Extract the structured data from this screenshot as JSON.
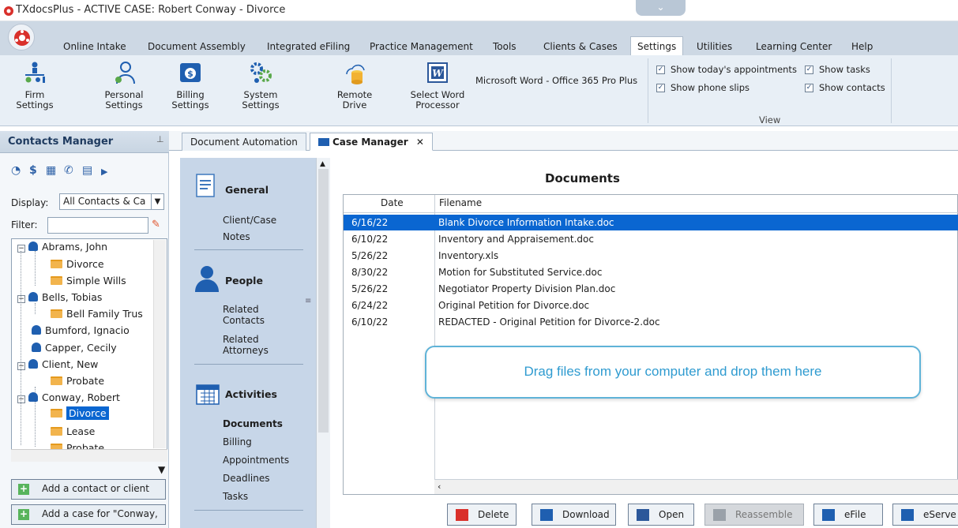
{
  "window": {
    "title": "TXdocsPlus - ACTIVE CASE: Robert Conway - Divorce"
  },
  "ribbon_tabs": [
    "Online Intake",
    "Document Assembly",
    "Integrated eFiling",
    "Practice Management",
    "Tools",
    "Clients & Cases",
    "Settings",
    "Utilities",
    "Learning Center",
    "Help"
  ],
  "active_tab": "Settings",
  "ribbon": {
    "buttons": [
      {
        "line1": "Firm",
        "line2": "Settings",
        "icon": "firm-settings-icon"
      },
      {
        "line1": "Personal",
        "line2": "Settings",
        "icon": "person-settings-icon"
      },
      {
        "line1": "Billing",
        "line2": "Settings",
        "icon": "billing-settings-icon"
      },
      {
        "line1": "System",
        "line2": "Settings",
        "icon": "gears-icon"
      },
      {
        "line1": "Remote",
        "line2": "Drive",
        "icon": "remote-drive-icon"
      },
      {
        "line1": "Select Word",
        "line2": "Processor",
        "icon": "word-icon"
      }
    ],
    "word_processor": "Microsoft Word - Office 365 Pro Plus",
    "checkboxes": [
      {
        "label": "Show today's appointments",
        "checked": true
      },
      {
        "label": "Show tasks",
        "checked": true
      },
      {
        "label": "Show phone slips",
        "checked": true
      },
      {
        "label": "Show contacts",
        "checked": true
      }
    ],
    "group_label": "View"
  },
  "contacts_manager": {
    "title": "Contacts Manager",
    "display_label": "Display:",
    "display_value": "All Contacts & Ca",
    "filter_label": "Filter:",
    "tree": [
      {
        "text": "Abrams, John",
        "type": "person",
        "level": 0,
        "expander": "−"
      },
      {
        "text": "Divorce",
        "type": "case",
        "level": 1
      },
      {
        "text": "Simple Wills",
        "type": "case",
        "level": 1
      },
      {
        "text": "Bells, Tobias",
        "type": "person",
        "level": 0,
        "expander": "−"
      },
      {
        "text": "Bell Family Trus",
        "type": "case",
        "level": 1
      },
      {
        "text": "Bumford, Ignacio",
        "type": "person",
        "level": 0
      },
      {
        "text": "Capper, Cecily",
        "type": "person",
        "level": 0
      },
      {
        "text": "Client, New",
        "type": "person",
        "level": 0,
        "expander": "−"
      },
      {
        "text": "Probate",
        "type": "case",
        "level": 1
      },
      {
        "text": "Conway, Robert",
        "type": "person",
        "level": 0,
        "expander": "−"
      },
      {
        "text": "Divorce",
        "type": "case",
        "level": 1,
        "selected": true
      },
      {
        "text": "Lease",
        "type": "case",
        "level": 1
      },
      {
        "text": "Probate",
        "type": "case",
        "level": 1
      }
    ],
    "add_contact": "Add a contact or client",
    "add_case": "Add a case for \"Conway,"
  },
  "doc_tabs": [
    "Document Automation",
    "Case Manager"
  ],
  "case_nav": {
    "general": {
      "heading": "General",
      "items": [
        "Client/Case",
        "Notes"
      ]
    },
    "people": {
      "heading": "People",
      "items": [
        "Related Contacts",
        "Related Attorneys"
      ]
    },
    "activities": {
      "heading": "Activities",
      "items": [
        "Documents",
        "Billing",
        "Appointments",
        "Deadlines",
        "Tasks"
      ],
      "active": "Documents"
    }
  },
  "documents": {
    "title": "Documents",
    "columns": [
      "Date",
      "Filename"
    ],
    "rows": [
      {
        "date": "6/16/22",
        "filename": "Blank Divorce Information Intake.doc",
        "selected": true
      },
      {
        "date": "6/10/22",
        "filename": "Inventory and Appraisement.doc"
      },
      {
        "date": "5/26/22",
        "filename": "Inventory.xls"
      },
      {
        "date": "8/30/22",
        "filename": "Motion for Substituted Service.doc"
      },
      {
        "date": "5/26/22",
        "filename": "Negotiator Property Division Plan.doc"
      },
      {
        "date": "6/24/22",
        "filename": "Original Petition for Divorce.doc"
      },
      {
        "date": "6/10/22",
        "filename": "REDACTED  - Original Petition for Divorce-2.doc"
      }
    ],
    "drop_hint": "Drag files from your computer and drop them here"
  },
  "actions": [
    {
      "label": "Delete",
      "color": "#d9302b"
    },
    {
      "label": "Download",
      "color": "#1f5fb0"
    },
    {
      "label": "Open",
      "color": "#2b579a"
    },
    {
      "label": "Reassemble",
      "color": "#8d939a",
      "disabled": true
    },
    {
      "label": "eFile",
      "color": "#1f5fb0"
    },
    {
      "label": "eServe",
      "color": "#1f5fb0"
    }
  ]
}
